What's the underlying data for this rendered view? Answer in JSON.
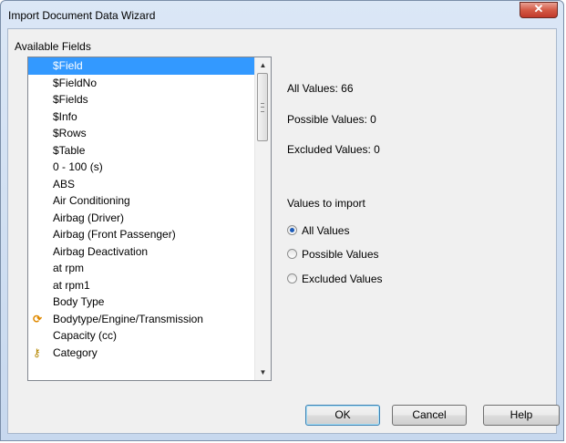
{
  "window": {
    "title": "Import Document Data Wizard",
    "close_symbol": "✕"
  },
  "fields": {
    "label": "Available Fields",
    "items": [
      {
        "label": "$Field",
        "selected": true
      },
      {
        "label": "$FieldNo"
      },
      {
        "label": "$Fields"
      },
      {
        "label": "$Info"
      },
      {
        "label": "$Rows"
      },
      {
        "label": "$Table"
      },
      {
        "label": "0 - 100 (s)"
      },
      {
        "label": "ABS"
      },
      {
        "label": "Air Conditioning"
      },
      {
        "label": "Airbag (Driver)"
      },
      {
        "label": "Airbag (Front Passenger)"
      },
      {
        "label": "Airbag Deactivation"
      },
      {
        "label": "at rpm"
      },
      {
        "label": "at rpm1"
      },
      {
        "label": "Body Type"
      },
      {
        "label": "Bodytype/Engine/Transmission",
        "icon": "cycle-group-icon"
      },
      {
        "label": "Capacity (cc)"
      },
      {
        "label": "Category",
        "icon": "key-icon"
      }
    ]
  },
  "info": {
    "all_values": "All Values: 66",
    "possible_values": "Possible Values: 0",
    "excluded_values": "Excluded Values: 0"
  },
  "import": {
    "label": "Values to import",
    "options": [
      {
        "label": "All Values",
        "checked": true
      },
      {
        "label": "Possible Values",
        "checked": false
      },
      {
        "label": "Excluded Values",
        "checked": false
      }
    ]
  },
  "buttons": {
    "ok": "OK",
    "cancel": "Cancel",
    "help": "Help"
  },
  "colors": {
    "selection": "#3399ff",
    "close_button": "#c0392b",
    "title_bar": "#c7d8ee"
  }
}
